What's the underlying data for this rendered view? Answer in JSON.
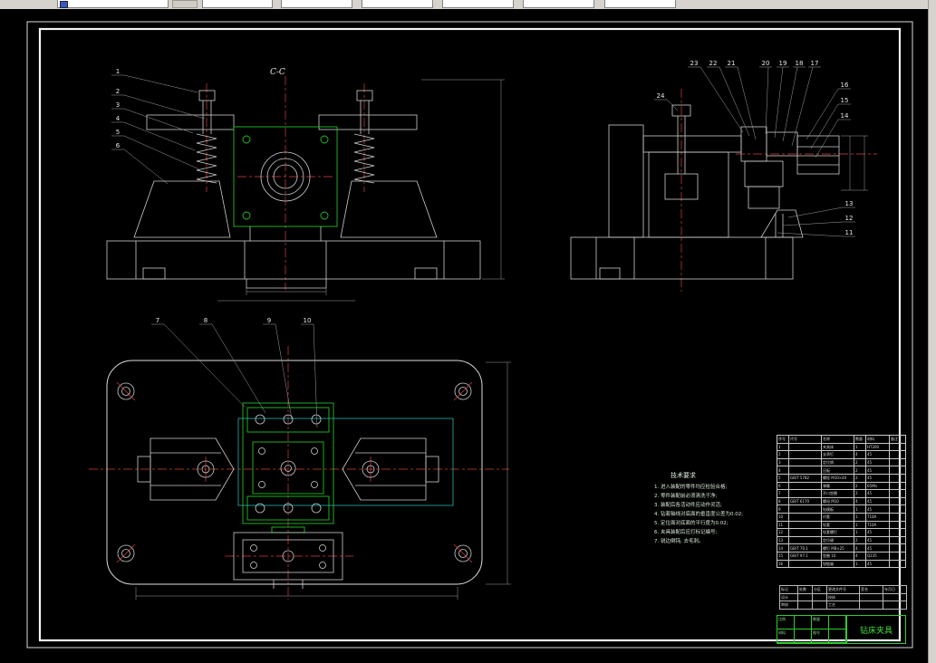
{
  "toolbar": {
    "combo_values": [
      "",
      "",
      "",
      "",
      "",
      "",
      ""
    ]
  },
  "drawing": {
    "section_label": "C-C",
    "callout_numbers": [
      "1",
      "2",
      "3",
      "4",
      "5",
      "6",
      "7",
      "8",
      "9",
      "10",
      "11",
      "12",
      "13",
      "14",
      "15",
      "16",
      "17",
      "18",
      "19",
      "20",
      "21",
      "22",
      "23",
      "24"
    ],
    "notes": {
      "title": "技术要求",
      "lines": [
        "1. 进入装配的零件均应检验合格;",
        "2. 零件装配前必须清洗干净;",
        "3. 装配后各活动件应动作灵活;",
        "4. 钻套轴线对底面的垂直度公差为0.02;",
        "5. 定位面对底面的平行度为0.02;",
        "6. 夹具装配后应打标记编号;",
        "7. 锐边倒钝, 去毛刺。"
      ]
    },
    "bom": {
      "headers": [
        "序号",
        "代号",
        "名称",
        "数量",
        "材料",
        "备注"
      ],
      "rows": [
        [
          "1",
          "",
          "夹具体",
          "1",
          "HT200",
          ""
        ],
        [
          "2",
          "",
          "支承钉",
          "4",
          "45",
          ""
        ],
        [
          "3",
          "",
          "定位销",
          "2",
          "45",
          ""
        ],
        [
          "4",
          "",
          "压板",
          "2",
          "45",
          ""
        ],
        [
          "5",
          "GB/T 5782",
          "螺栓 M10×40",
          "2",
          "45",
          ""
        ],
        [
          "6",
          "",
          "弹簧",
          "2",
          "65Mn",
          ""
        ],
        [
          "7",
          "",
          "开口垫圈",
          "2",
          "45",
          ""
        ],
        [
          "8",
          "GB/T 6170",
          "螺母 M10",
          "4",
          "45",
          ""
        ],
        [
          "9",
          "",
          "钻模板",
          "1",
          "45",
          ""
        ],
        [
          "10",
          "",
          "衬套",
          "1",
          "T10A",
          ""
        ],
        [
          "11",
          "",
          "钻套",
          "1",
          "T10A",
          ""
        ],
        [
          "12",
          "",
          "钻套螺钉",
          "1",
          "45",
          ""
        ],
        [
          "13",
          "",
          "定位键",
          "2",
          "45",
          ""
        ],
        [
          "14",
          "GB/T 70.1",
          "螺钉 M8×25",
          "4",
          "45",
          ""
        ],
        [
          "15",
          "GB/T 97.1",
          "垫圈 10",
          "4",
          "Q235",
          ""
        ],
        [
          "16",
          "",
          "铰链轴",
          "1",
          "45",
          ""
        ]
      ]
    },
    "revision_rows": [
      [
        "标记",
        "处数",
        "分区",
        "更改文件号",
        "签名",
        "年月日"
      ],
      [
        "设计",
        "",
        "",
        "校核",
        "",
        ""
      ],
      [
        "审核",
        "",
        "",
        "工艺",
        "",
        ""
      ]
    ],
    "title_block": {
      "title": "钻床夹具",
      "cells": [
        [
          "比例",
          ""
        ],
        [
          "数量",
          ""
        ],
        [
          "材料",
          ""
        ],
        [
          "图号",
          ""
        ]
      ]
    }
  }
}
